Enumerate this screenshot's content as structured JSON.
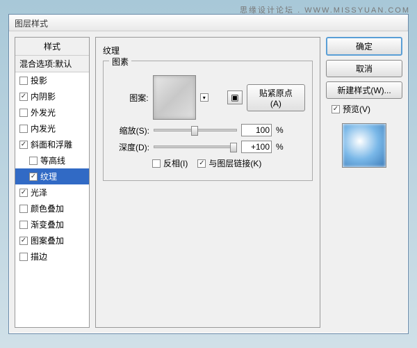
{
  "watermark": "思缘设计论坛 . WWW.MISSYUAN.COM",
  "dialog": {
    "title": "图层样式"
  },
  "styles": {
    "header": "样式",
    "blend": "混合选项:默认",
    "items": [
      {
        "label": "投影",
        "checked": false
      },
      {
        "label": "内阴影",
        "checked": true
      },
      {
        "label": "外发光",
        "checked": false
      },
      {
        "label": "内发光",
        "checked": false
      },
      {
        "label": "斜面和浮雕",
        "checked": true
      },
      {
        "label": "等高线",
        "checked": false,
        "sub": true
      },
      {
        "label": "纹理",
        "checked": true,
        "sub": true,
        "selected": true
      },
      {
        "label": "光泽",
        "checked": true
      },
      {
        "label": "颜色叠加",
        "checked": false
      },
      {
        "label": "渐变叠加",
        "checked": false
      },
      {
        "label": "图案叠加",
        "checked": true
      },
      {
        "label": "描边",
        "checked": false
      }
    ]
  },
  "texture": {
    "title": "纹理",
    "element_group": "图素",
    "pattern_label": "图案:",
    "snap_origin": "贴紧原点(A)",
    "scale_label": "缩放(S):",
    "scale_value": "100",
    "depth_label": "深度(D):",
    "depth_value": "+100",
    "percent": "%",
    "invert_label": "反相(I)",
    "invert_checked": false,
    "link_label": "与图层链接(K)",
    "link_checked": true
  },
  "buttons": {
    "ok": "确定",
    "cancel": "取消",
    "new_style": "新建样式(W)...",
    "preview": "预览(V)"
  }
}
